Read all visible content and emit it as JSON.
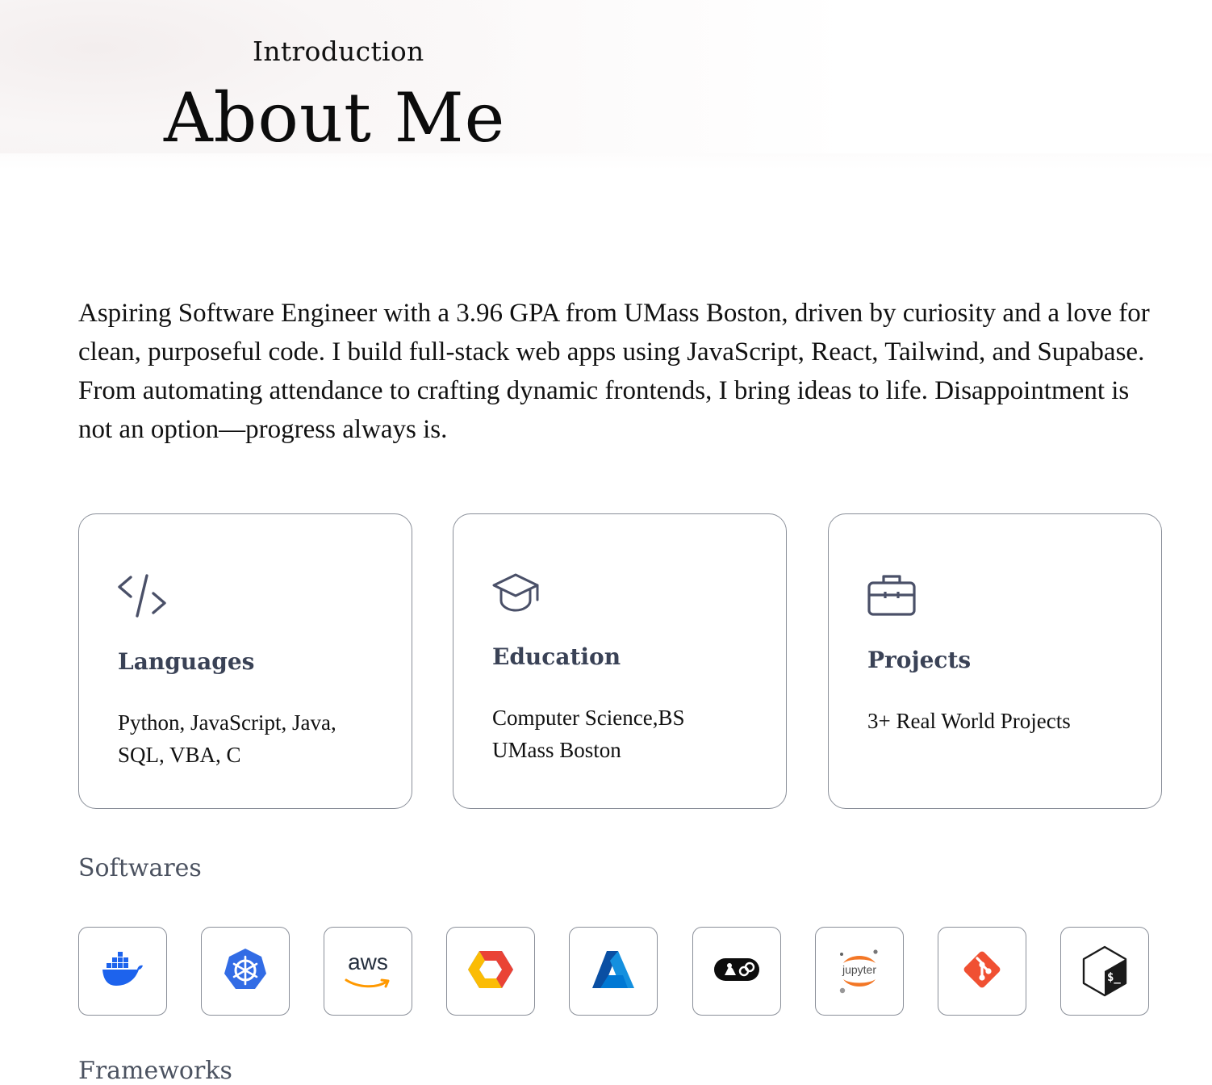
{
  "header": {
    "intro_label": "Introduction",
    "title": "About Me"
  },
  "bio": "Aspiring Software Engineer with a 3.96 GPA from UMass Boston, driven by curiosity and a love for clean, purposeful code. I build full-stack web apps using JavaScript, React, Tailwind, and Supabase. From automating attendance to crafting dynamic frontends, I bring ideas to life. Disappointment is not an option—progress always is.",
  "cards": [
    {
      "icon": "code-icon",
      "title": "Languages",
      "body": [
        "Python, JavaScript, Java,",
        "SQL, VBA, C"
      ]
    },
    {
      "icon": "graduation-cap-icon",
      "title": "Education",
      "body": [
        "Computer Science,BS",
        "UMass Boston"
      ]
    },
    {
      "icon": "briefcase-icon",
      "title": "Projects",
      "body": [
        "3+ Real World Projects"
      ]
    }
  ],
  "softwares": {
    "label": "Softwares",
    "items": [
      {
        "icon": "docker-icon"
      },
      {
        "icon": "kubernetes-icon"
      },
      {
        "icon": "aws-icon",
        "text": "aws"
      },
      {
        "icon": "google-cloud-icon"
      },
      {
        "icon": "azure-icon"
      },
      {
        "icon": "postman-icon"
      },
      {
        "icon": "jupyter-icon",
        "text": "jupyter"
      },
      {
        "icon": "git-icon"
      },
      {
        "icon": "bash-icon",
        "text": "$_"
      }
    ]
  },
  "frameworks": {
    "label": "Frameworks"
  },
  "colors": {
    "card_border": "#8a8f99",
    "card_title": "#3a4256",
    "icon_stroke": "#4a5068",
    "docker": "#1d63ed",
    "kubernetes": "#326ce5",
    "aws_orange": "#ff9900",
    "azure": "#0078d4",
    "jupyter_orange": "#f37726",
    "git": "#f05032"
  }
}
